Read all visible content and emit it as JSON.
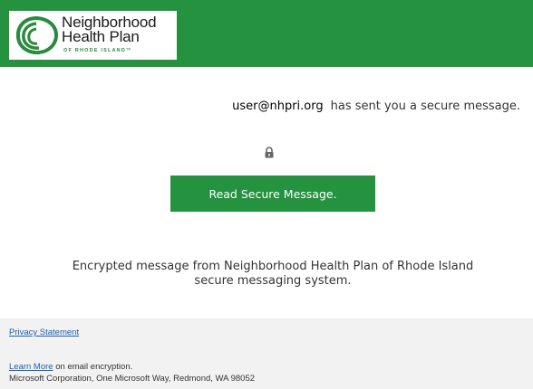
{
  "header": {
    "logo": {
      "name_line1": "Neighborhood",
      "name_line2": "Health Plan",
      "subtitle": "OF RHODE ISLAND™"
    },
    "color": "#24923f"
  },
  "message": {
    "sender_email": "user@nhpri.org",
    "sender_text": "has sent you a secure message.",
    "lock_icon": "lock-icon",
    "read_button_label": "Read Secure Message.",
    "encrypted_line1": "Encrypted message from Neighborhood Health Plan of Rhode Island",
    "encrypted_line2": "secure messaging system."
  },
  "footer": {
    "privacy_link": "Privacy Statement",
    "learn_more_link": "Learn More",
    "learn_more_text": " on email encryption.",
    "corporation": "Microsoft Corporation, One Microsoft Way, Redmond, WA 98052"
  },
  "colors": {
    "brand_green": "#24923f",
    "link_blue": "#1a5fb4",
    "footer_bg": "#f2f2f2"
  }
}
